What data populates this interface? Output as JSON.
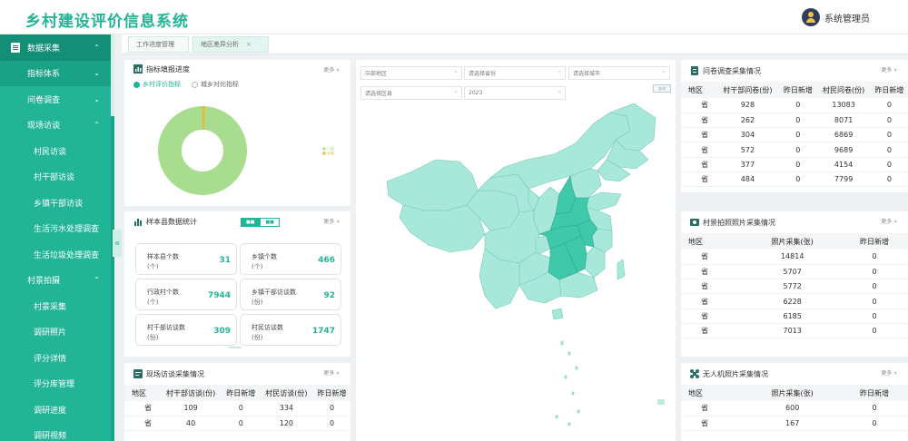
{
  "app": {
    "title": "乡村建设评价信息系统",
    "user": "系统管理员"
  },
  "sidebar": {
    "items": [
      {
        "label": "数据采集",
        "level": "head",
        "chev": "⌃"
      },
      {
        "label": "指标体系",
        "level": "l1",
        "chev": "⌄",
        "active": true
      },
      {
        "label": "问卷调查",
        "level": "l1",
        "chev": "⌄"
      },
      {
        "label": "现场访谈",
        "level": "l1",
        "chev": "⌃"
      },
      {
        "label": "村民访谈",
        "level": "l2"
      },
      {
        "label": "村干部访谈",
        "level": "l2"
      },
      {
        "label": "乡镇干部访谈",
        "level": "l2"
      },
      {
        "label": "生活污水处理调查",
        "level": "l2"
      },
      {
        "label": "生活垃圾处理调查",
        "level": "l2"
      },
      {
        "label": "村景拍摄",
        "level": "l1",
        "chev": "⌃"
      },
      {
        "label": "村景采集",
        "level": "l2"
      },
      {
        "label": "调研照片",
        "level": "l2"
      },
      {
        "label": "评分详情",
        "level": "l2"
      },
      {
        "label": "评分库管理",
        "level": "l2"
      },
      {
        "label": "调研进度",
        "level": "l2"
      },
      {
        "label": "调研视频",
        "level": "l2"
      }
    ]
  },
  "tabs": [
    {
      "label": "工作进度管理"
    },
    {
      "label": "地区差异分析",
      "close": "×"
    }
  ],
  "progress": {
    "title": "指标填报进度",
    "more": "更多 »",
    "radios": [
      "乡村评价指标",
      "城乡对比指标"
    ],
    "donut_fraction_filled": 0.99,
    "legend": [
      "■ 已填",
      "■ 未填"
    ]
  },
  "sample": {
    "title": "样本县数据统计",
    "more": "更多 »",
    "toggle": [
      "■■",
      "■■"
    ],
    "stats": [
      {
        "label": "样本县个数",
        "unit": "(个)",
        "value": "31"
      },
      {
        "label": "乡镇个数",
        "unit": "(个)",
        "value": "466"
      },
      {
        "label": "行政村个数",
        "unit": "(个)",
        "value": "7944"
      },
      {
        "label": "乡镇干部访谈数",
        "unit": "(份)",
        "value": "92"
      },
      {
        "label": "村干部访谈数",
        "unit": "(份)",
        "value": "309"
      },
      {
        "label": "村民访谈数",
        "unit": "(份)",
        "value": "1747"
      }
    ]
  },
  "interview": {
    "title": "现场访谈采集情况",
    "more": "更多 »",
    "headers": [
      "地区",
      "村干部访谈(份)",
      "昨日新增",
      "村民访谈(份)",
      "昨日新增"
    ],
    "rows": [
      [
        "省",
        "109",
        "0",
        "334",
        "0"
      ],
      [
        "省",
        "40",
        "0",
        "120",
        "0"
      ]
    ]
  },
  "map": {
    "selects": [
      "中部地区",
      "请选择省份",
      "请选择城市",
      "请选择区县",
      "2023"
    ],
    "query": "查询",
    "colors": {
      "base": "#a8e8da",
      "highlight": "#3fc8aa",
      "border": "#7fd3c0"
    }
  },
  "questionnaire": {
    "title": "问卷调查采集情况",
    "more": "更多 »",
    "headers": [
      "地区",
      "村干部问卷(份)",
      "昨日新增",
      "村民问卷(份)",
      "昨日新增"
    ],
    "rows": [
      [
        "省",
        "928",
        "0",
        "13083",
        "0"
      ],
      [
        "省",
        "262",
        "0",
        "8071",
        "0"
      ],
      [
        "省",
        "304",
        "0",
        "6869",
        "0"
      ],
      [
        "省",
        "572",
        "0",
        "9689",
        "0"
      ],
      [
        "省",
        "377",
        "0",
        "4154",
        "0"
      ],
      [
        "省",
        "484",
        "0",
        "7799",
        "0"
      ]
    ]
  },
  "village_photos": {
    "title": "村景拍照照片采集情况",
    "more": "更多 »",
    "headers": [
      "地区",
      "照片采集(张)",
      "昨日新增"
    ],
    "rows": [
      [
        "省",
        "14814",
        "0"
      ],
      [
        "省",
        "5707",
        "0"
      ],
      [
        "省",
        "5772",
        "0"
      ],
      [
        "省",
        "6228",
        "0"
      ],
      [
        "省",
        "6185",
        "0"
      ],
      [
        "省",
        "7013",
        "0"
      ]
    ]
  },
  "drone_photos": {
    "title": "无人机照片采集情况",
    "more": "更多 »",
    "headers": [
      "地区",
      "照片采集(张)",
      "昨日新增"
    ],
    "rows": [
      [
        "省",
        "600",
        "0"
      ],
      [
        "省",
        "167",
        "0"
      ]
    ]
  }
}
